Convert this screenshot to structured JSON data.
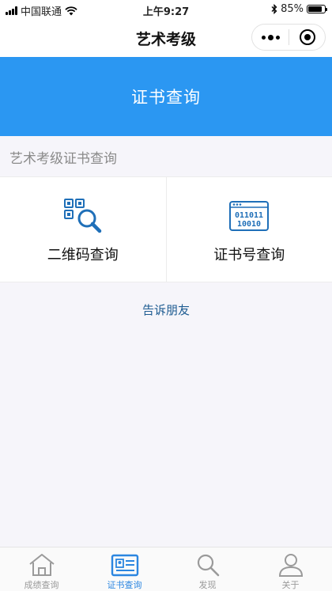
{
  "status_bar": {
    "carrier": "中国联通",
    "time": "上午9:27",
    "battery_text": "85%",
    "battery_level": 0.85,
    "icons": [
      "signal-icon",
      "wifi-icon",
      "bluetooth-icon",
      "battery-icon"
    ]
  },
  "nav": {
    "title": "艺术考级",
    "icons": [
      "more-icon",
      "close-target-icon"
    ]
  },
  "banner": {
    "title": "证书查询",
    "color": "#2b97f2"
  },
  "section": {
    "label": "艺术考级证书查询"
  },
  "cards": [
    {
      "label": "二维码查询",
      "icon": "qr-search-icon"
    },
    {
      "label": "证书号查询",
      "icon": "binary-code-icon"
    }
  ],
  "share_link": "告诉朋友",
  "tabbar": {
    "active_color": "#2b86e0",
    "items": [
      {
        "label": "成绩查询",
        "icon": "home-icon",
        "active": false
      },
      {
        "label": "证书查询",
        "icon": "certificate-icon",
        "active": true
      },
      {
        "label": "发现",
        "icon": "search-icon",
        "active": false
      },
      {
        "label": "关于",
        "icon": "user-icon",
        "active": false
      }
    ]
  }
}
